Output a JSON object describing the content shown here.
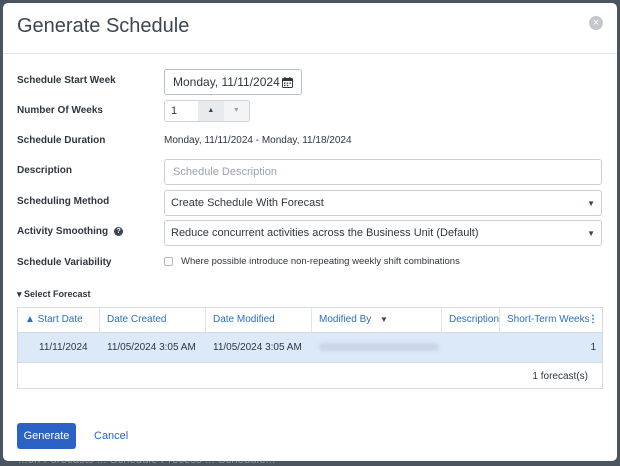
{
  "backdrop": {
    "text": "...on Forecasts ... Schedule Process ... Schedule..."
  },
  "dialog": {
    "title": "Generate Schedule",
    "close_glyph": "×"
  },
  "form": {
    "start_week": {
      "label": "Schedule Start Week",
      "value": "Monday, 11/11/2024"
    },
    "num_weeks": {
      "label": "Number Of Weeks",
      "value": "1",
      "up_glyph": "▲",
      "down_glyph": "▼"
    },
    "duration": {
      "label": "Schedule Duration",
      "value": "Monday, 11/11/2024 - Monday, 11/18/2024"
    },
    "description": {
      "label": "Description",
      "placeholder": "Schedule Description"
    },
    "method": {
      "label": "Scheduling Method",
      "value": "Create Schedule With Forecast",
      "caret": "▼"
    },
    "smoothing": {
      "label": "Activity Smoothing",
      "help_glyph": "?",
      "value": "Reduce concurrent activities across the Business Unit (Default)",
      "caret": "▼"
    },
    "variability": {
      "label": "Schedule Variability",
      "checkbox_label": "Where possible introduce non-repeating weekly shift combinations"
    }
  },
  "forecast": {
    "section_label": "▾ Select Forecast",
    "columns": {
      "start_date": "▲ Start Date",
      "date_created": "Date Created",
      "date_modified": "Date Modified",
      "modified_by": "Modified By",
      "description": "Description",
      "short_term_weeks": "Short-Term Weeks"
    },
    "filter_glyph": "▼",
    "menu_glyph": "⋮",
    "rows": [
      {
        "start_date": "11/11/2024",
        "date_created": "11/05/2024 3:05 AM",
        "date_modified": "11/05/2024 3:05 AM",
        "description": "",
        "short_term_weeks": "1"
      }
    ],
    "count_text": "1 forecast(s)"
  },
  "actions": {
    "generate": "Generate",
    "cancel": "Cancel"
  },
  "colors": {
    "accent": "#2a63c5",
    "selected_row": "#dce9f9"
  }
}
